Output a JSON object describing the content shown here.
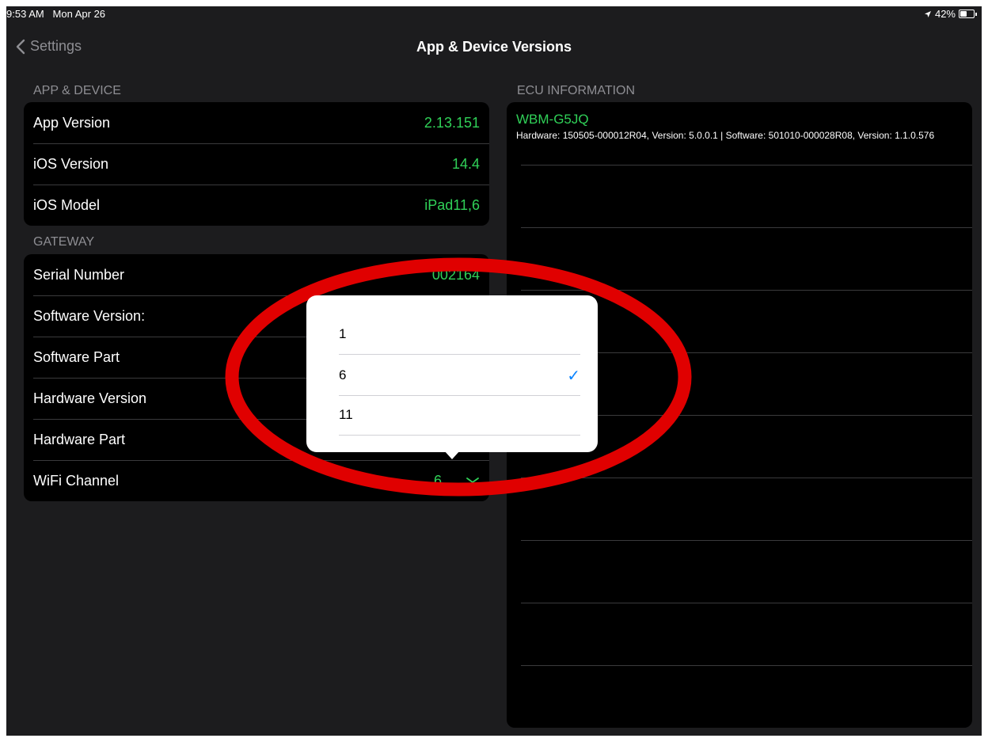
{
  "status": {
    "time": "9:53 AM",
    "date": "Mon Apr 26",
    "battery": "42%"
  },
  "nav": {
    "back_label": "Settings",
    "title": "App & Device Versions"
  },
  "app_device": {
    "header": "APP & DEVICE",
    "rows": [
      {
        "label": "App Version",
        "value": "2.13.151"
      },
      {
        "label": "iOS Version",
        "value": "14.4"
      },
      {
        "label": "iOS Model",
        "value": "iPad11,6"
      }
    ]
  },
  "gateway": {
    "header": "GATEWAY",
    "rows": [
      {
        "label": "Serial Number",
        "value": "002164"
      },
      {
        "label": "Software Version:",
        "value": ""
      },
      {
        "label": "Software Part",
        "value": ""
      },
      {
        "label": "Hardware Version",
        "value": ""
      },
      {
        "label": "Hardware Part",
        "value": ""
      },
      {
        "label": "WiFi Channel",
        "value": "6"
      }
    ]
  },
  "ecu": {
    "header": "ECU INFORMATION",
    "name": "WBM-G5JQ",
    "detail": "Hardware: 150505-000012R04, Version: 5.0.0.1 | Software: 501010-000028R08, Version: 1.1.0.576"
  },
  "channel_picker": {
    "options": [
      "1",
      "6",
      "11"
    ],
    "selected": "6",
    "check_glyph": "✓"
  },
  "colors": {
    "accent_green": "#30d158",
    "accent_blue": "#0a84ff",
    "highlight_red": "#e00000"
  }
}
